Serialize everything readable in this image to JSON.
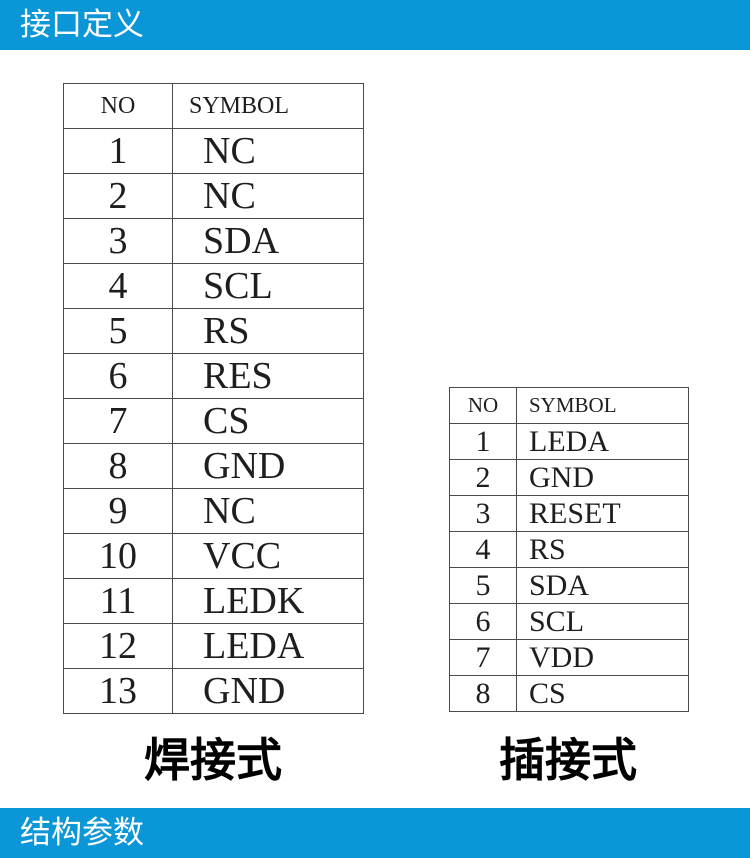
{
  "sections": {
    "interface_title": "接口定义",
    "structure_title": "结构参数"
  },
  "solder_table": {
    "headers": [
      "NO",
      "SYMBOL"
    ],
    "rows": [
      [
        "1",
        "NC"
      ],
      [
        "2",
        "NC"
      ],
      [
        "3",
        "SDA"
      ],
      [
        "4",
        "SCL"
      ],
      [
        "5",
        "RS"
      ],
      [
        "6",
        "RES"
      ],
      [
        "7",
        "CS"
      ],
      [
        "8",
        "GND"
      ],
      [
        "9",
        "NC"
      ],
      [
        "10",
        "VCC"
      ],
      [
        "11",
        "LEDK"
      ],
      [
        "12",
        "LEDA"
      ],
      [
        "13",
        "GND"
      ]
    ],
    "caption": "焊接式"
  },
  "plug_table": {
    "headers": [
      "NO",
      "SYMBOL"
    ],
    "rows": [
      [
        "1",
        "LEDA"
      ],
      [
        "2",
        "GND"
      ],
      [
        "3",
        "RESET"
      ],
      [
        "4",
        "RS"
      ],
      [
        "5",
        "SDA"
      ],
      [
        "6",
        "SCL"
      ],
      [
        "7",
        "VDD"
      ],
      [
        "8",
        "CS"
      ]
    ],
    "caption": "插接式"
  },
  "colors": {
    "section_bar": "#0b96d8",
    "table_border": "#4a4a4a",
    "text": "#1e1e1e"
  }
}
